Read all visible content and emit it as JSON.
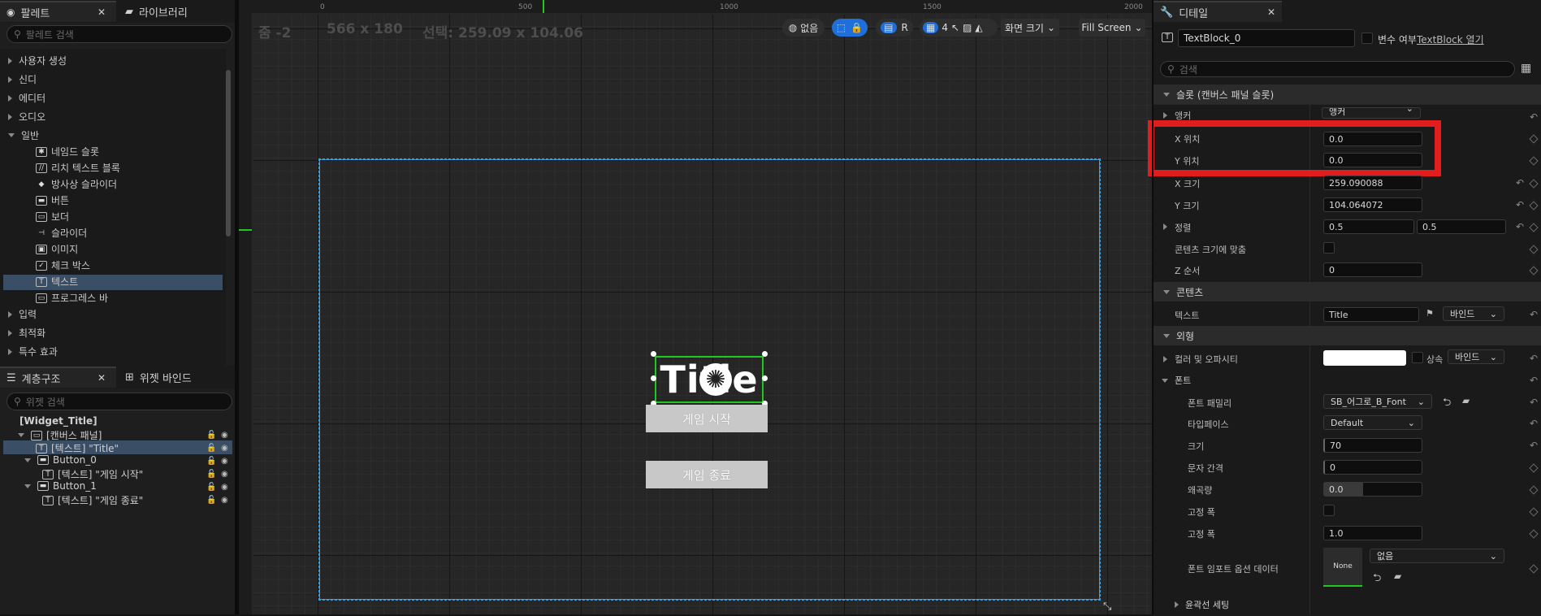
{
  "palette": {
    "tab_label": "팔레트",
    "library_tab": "라이브러리",
    "search_placeholder": "팔레트 검색",
    "categories_top": [
      "사용자 생성",
      "신디",
      "에디터",
      "오디오",
      "일반"
    ],
    "items": [
      {
        "icon": "✱",
        "label": "네임드 슬롯"
      },
      {
        "icon": "//",
        "label": "리치 텍스트 블록"
      },
      {
        "icon": "◆",
        "label": "방사상 슬라이더"
      },
      {
        "icon": "▬",
        "label": "버튼"
      },
      {
        "icon": "▭",
        "label": "보더"
      },
      {
        "icon": "⊣",
        "label": "슬라이더"
      },
      {
        "icon": "▣",
        "label": "이미지"
      },
      {
        "icon": "✓",
        "label": "체크 박스"
      },
      {
        "icon": "T",
        "label": "텍스트"
      },
      {
        "icon": "▭",
        "label": "프로그레스 바"
      }
    ],
    "categories_bottom": [
      "입력",
      "최적화",
      "특수 효과"
    ]
  },
  "hierarchy": {
    "tab_label": "계층구조",
    "bind_tab": "위젯 바인드",
    "search_placeholder": "위젯 검색",
    "root": "[Widget_Title]",
    "nodes": [
      {
        "label": "[캔버스 패널]",
        "indent": 0
      },
      {
        "label": "[텍스트] \"Title\"",
        "indent": 1
      },
      {
        "label": "Button_0",
        "indent": 1
      },
      {
        "label": "[텍스트] \"게임 시작\"",
        "indent": 2
      },
      {
        "label": "Button_1",
        "indent": 1
      },
      {
        "label": "[텍스트] \"게임 종료\"",
        "indent": 2
      }
    ]
  },
  "viewport": {
    "zoom": "줌 -2",
    "resolution": "566 x 180",
    "selection": "선택: 259.09 x 104.06",
    "ruler_ticks": [
      "0",
      "500",
      "1000",
      "1500",
      "2000"
    ],
    "toolbar": {
      "none_label": "없음",
      "r_label": "R",
      "grid_count": "4",
      "screen_size": "화면 크기",
      "fill_screen": "Fill Screen"
    },
    "title_text": "Title",
    "start_button": "게임 시작",
    "quit_button": "게임 종료"
  },
  "details": {
    "tab_label": "디테일",
    "widget_name": "TextBlock_0",
    "is_variable": "변수 여부",
    "open_link": "TextBlock 열기",
    "search_placeholder": "검색",
    "section_slot": "슬롯 (캔버스 패널 슬롯)",
    "anchor_label": "앵커",
    "anchor_value": "앵커",
    "pos_x_label": "X 위치",
    "pos_x": "0.0",
    "pos_y_label": "Y 위치",
    "pos_y": "0.0",
    "size_x_label": "X 크기",
    "size_x": "259.090088",
    "size_y_label": "Y 크기",
    "size_y": "104.064072",
    "alignment_label": "정렬",
    "align_x": "0.5",
    "align_y": "0.5",
    "size_to_content": "콘텐츠 크기에 맞춤",
    "zorder_label": "Z 순서",
    "zorder": "0",
    "section_content": "콘텐츠",
    "text_label": "텍스트",
    "text_value": "Title",
    "bind_label": "바인드",
    "section_appearance": "외형",
    "color_label": "컬러 및 오파시티",
    "inherit_label": "상속",
    "section_font": "폰트",
    "font_family_label": "폰트 패밀리",
    "font_family": "SB_어그로_B_Font",
    "typeface_label": "타입페이스",
    "typeface": "Default",
    "size_label": "크기",
    "size": "70",
    "letter_spacing_label": "문자 간격",
    "letter_spacing": "0",
    "skew_label": "왜곡량",
    "skew": "0.0",
    "monospace_label": "고정 폭",
    "monospace_width_label": "고정 폭",
    "monospace_width": "1.0",
    "font_import_label": "폰트 임포트 옵션 데이터",
    "none_thumb": "None",
    "none_value": "없음",
    "outline_label": "윤곽선 세팅"
  },
  "colors": {
    "highlight": "#e21d1d",
    "selection": "#3aa0e0",
    "accent": "#1e6fd9"
  }
}
